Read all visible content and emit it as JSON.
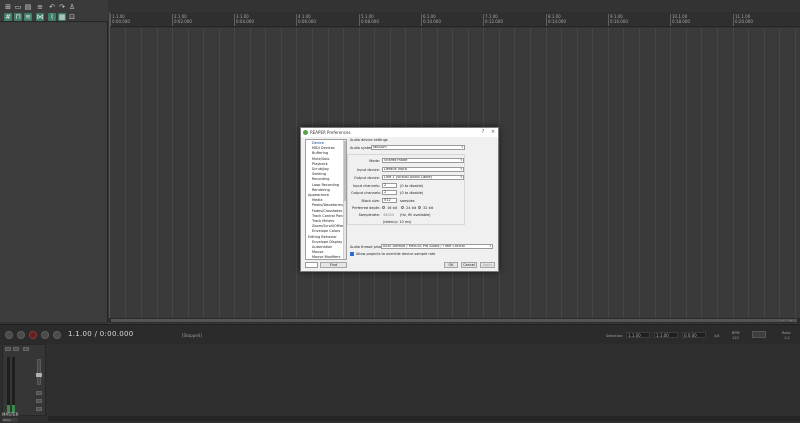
{
  "ruler": {
    "labels": [
      "1.1.00\n0:00.000",
      "2.1.00\n0:02.000",
      "3.1.00\n0:04.000",
      "4.1.00\n0:06.000",
      "5.1.00\n0:08.000",
      "6.1.00\n0:10.000",
      "7.1.00\n0:12.000",
      "8.1.00\n0:14.000",
      "9.1.00\n0:16.000",
      "10.1.00\n0:18.000",
      "11.1.00\n0:20.000"
    ]
  },
  "transport": {
    "position": "1.1.00 / 0:00.000",
    "status": "[Stopped]",
    "selection_label": "Selection:",
    "sel_start": "1.1.00",
    "sel_end": "1.1.00",
    "sel_len": "0.0.00",
    "time_sig": "4/4",
    "bpm_label": "BPM",
    "bpm_value": "120",
    "rate_label": "Rate:",
    "rate_value": "1.0"
  },
  "mixer": {
    "master_label": "MASTER",
    "tab_label": "Mixer"
  },
  "dialog": {
    "title": "REAPER Preferences",
    "help_icon": "?",
    "close_icon": "×",
    "list_items": [
      {
        "label": "Device",
        "indent": true,
        "selected": true
      },
      {
        "label": "MIDI Devices",
        "indent": true
      },
      {
        "label": "Buffering",
        "indent": true
      },
      {
        "label": "Mute/Solo",
        "indent": true
      },
      {
        "label": "Playback",
        "indent": true
      },
      {
        "label": "Scrub/Jog",
        "indent": true
      },
      {
        "label": "Seeking",
        "indent": true
      },
      {
        "label": "Recording",
        "indent": true
      },
      {
        "label": "Loop Recording",
        "indent": true
      },
      {
        "label": "Rendering",
        "indent": true
      },
      {
        "label": "Appearance",
        "indent": false
      },
      {
        "label": "Media",
        "indent": true
      },
      {
        "label": "Peaks/Waveforms",
        "indent": true
      },
      {
        "label": "Fades/Crossfades",
        "indent": true
      },
      {
        "label": "Track Control Panels",
        "indent": true
      },
      {
        "label": "Track Meters",
        "indent": true
      },
      {
        "label": "Zoom/Scroll/Offset",
        "indent": true
      },
      {
        "label": "Envelope Colors",
        "indent": true
      },
      {
        "label": "Editing Behavior",
        "indent": false
      },
      {
        "label": "Envelope Display",
        "indent": true
      },
      {
        "label": "Automation",
        "indent": true
      },
      {
        "label": "Mouse",
        "indent": true
      },
      {
        "label": "Mouse Modifiers",
        "indent": true
      }
    ],
    "find_label": "Find",
    "section_title": "Audio device settings",
    "audio_system_label": "Audio system:",
    "audio_system_value": "WASAPI",
    "mode_label": "Mode:",
    "mode_value": "Shared mode",
    "input_device_label": "Input device:",
    "input_device_value": "Default input",
    "output_device_label": "Output device:",
    "output_device_value": "Line 1 (Virtual Audio Cable)",
    "input_channels_label": "Input channels:",
    "input_channels_value": "2",
    "input_channels_note": "(0 to disable)",
    "output_channels_label": "Output channels:",
    "output_channels_value": "2",
    "output_channels_note": "(0 to disable)",
    "block_size_label": "Block size:",
    "block_size_value": "512",
    "block_size_unit": "samples",
    "preferred_depth_label": "Preferred depth:",
    "depth_16": "16 bit",
    "depth_24": "24 bit",
    "depth_32": "32 bit",
    "samplerate_label": "Samplerate:",
    "samplerate_value": "48000",
    "samplerate_note": "(Hz, fill available)",
    "latency_text": "(latency: 10 ms)",
    "thread_priority_label": "Audio thread priority:",
    "thread_priority_value": "ASIO Default / MMCSS Pro Audio / Time Critical",
    "allow_projects_label": "Allow projects to override device sample rate",
    "ok_label": "OK",
    "cancel_label": "Cancel",
    "apply_label": "Apply"
  }
}
